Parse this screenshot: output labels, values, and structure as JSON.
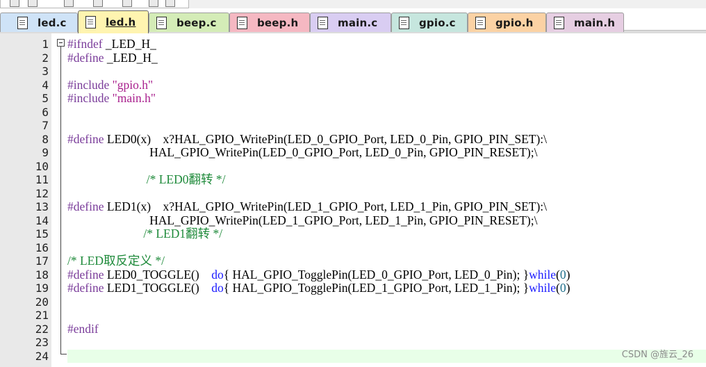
{
  "tabs": [
    {
      "label": "led.c",
      "color": "#cfe3f7",
      "active": false
    },
    {
      "label": "led.h",
      "color": "#fff4b0",
      "active": true
    },
    {
      "label": "beep.c",
      "color": "#d4ecb7",
      "active": false
    },
    {
      "label": "beep.h",
      "color": "#f5b8c2",
      "active": false
    },
    {
      "label": "main.c",
      "color": "#d9cdf2",
      "active": false
    },
    {
      "label": "gpio.c",
      "color": "#c6e6de",
      "active": false
    },
    {
      "label": "gpio.h",
      "color": "#fbd2a4",
      "active": false
    },
    {
      "label": "main.h",
      "color": "#e6cee2",
      "active": false
    }
  ],
  "editor": {
    "current_line": 24,
    "lines": [
      {
        "n": "1",
        "tokens": [
          {
            "t": "pp",
            "s": "#ifndef"
          },
          {
            "t": "",
            "s": " _LED_H_"
          }
        ]
      },
      {
        "n": "2",
        "tokens": [
          {
            "t": "pp",
            "s": "#define"
          },
          {
            "t": "",
            "s": " _LED_H_"
          }
        ]
      },
      {
        "n": "3",
        "tokens": []
      },
      {
        "n": "4",
        "tokens": [
          {
            "t": "pp",
            "s": "#include"
          },
          {
            "t": "",
            "s": " "
          },
          {
            "t": "str",
            "s": "\"gpio.h\""
          }
        ]
      },
      {
        "n": "5",
        "tokens": [
          {
            "t": "pp",
            "s": "#include"
          },
          {
            "t": "",
            "s": " "
          },
          {
            "t": "str",
            "s": "\"main.h\""
          }
        ]
      },
      {
        "n": "6",
        "tokens": []
      },
      {
        "n": "7",
        "tokens": []
      },
      {
        "n": "8",
        "tokens": [
          {
            "t": "pp",
            "s": "#define"
          },
          {
            "t": "",
            "s": " LED0(x)    x?HAL_GPIO_WritePin(LED_0_GPIO_Port, LED_0_Pin, GPIO_PIN_SET):\\"
          }
        ]
      },
      {
        "n": "9",
        "tokens": [
          {
            "t": "",
            "s": "                           HAL_GPIO_WritePin(LED_0_GPIO_Port, LED_0_Pin, GPIO_PIN_RESET);\\"
          }
        ]
      },
      {
        "n": "10",
        "tokens": []
      },
      {
        "n": "11",
        "tokens": [
          {
            "t": "cm",
            "s": "                          /* LED0翻转 */"
          }
        ]
      },
      {
        "n": "12",
        "tokens": []
      },
      {
        "n": "13",
        "tokens": [
          {
            "t": "pp",
            "s": "#define"
          },
          {
            "t": "",
            "s": " LED1(x)    x?HAL_GPIO_WritePin(LED_1_GPIO_Port, LED_1_Pin, GPIO_PIN_SET):\\"
          }
        ]
      },
      {
        "n": "14",
        "tokens": [
          {
            "t": "",
            "s": "                           HAL_GPIO_WritePin(LED_1_GPIO_Port, LED_1_Pin, GPIO_PIN_RESET);\\"
          }
        ]
      },
      {
        "n": "15",
        "tokens": [
          {
            "t": "cm",
            "s": "                         /* LED1翻转 */"
          }
        ]
      },
      {
        "n": "16",
        "tokens": []
      },
      {
        "n": "17",
        "tokens": [
          {
            "t": "cm",
            "s": "/* LED取反定义 */"
          }
        ]
      },
      {
        "n": "18",
        "tokens": [
          {
            "t": "pp",
            "s": "#define"
          },
          {
            "t": "",
            "s": " LED0_TOGGLE()    "
          },
          {
            "t": "kw",
            "s": "do"
          },
          {
            "t": "",
            "s": "{ HAL_GPIO_TogglePin(LED_0_GPIO_Port, LED_0_Pin); }"
          },
          {
            "t": "kw",
            "s": "while"
          },
          {
            "t": "",
            "s": "("
          },
          {
            "t": "num",
            "s": "0"
          },
          {
            "t": "",
            "s": ")"
          }
        ]
      },
      {
        "n": "19",
        "tokens": [
          {
            "t": "pp",
            "s": "#define"
          },
          {
            "t": "",
            "s": " LED1_TOGGLE()    "
          },
          {
            "t": "kw",
            "s": "do"
          },
          {
            "t": "",
            "s": "{ HAL_GPIO_TogglePin(LED_1_GPIO_Port, LED_1_Pin); }"
          },
          {
            "t": "kw",
            "s": "while"
          },
          {
            "t": "",
            "s": "("
          },
          {
            "t": "num",
            "s": "0"
          },
          {
            "t": "",
            "s": ")"
          }
        ]
      },
      {
        "n": "20",
        "tokens": []
      },
      {
        "n": "21",
        "tokens": []
      },
      {
        "n": "22",
        "tokens": [
          {
            "t": "pp",
            "s": "#endif"
          }
        ]
      },
      {
        "n": "23",
        "tokens": []
      },
      {
        "n": "24",
        "tokens": []
      }
    ]
  },
  "watermark": "CSDN @旌云_26",
  "icons": {
    "file": "file-icon",
    "fold": "fold-minus-icon"
  }
}
